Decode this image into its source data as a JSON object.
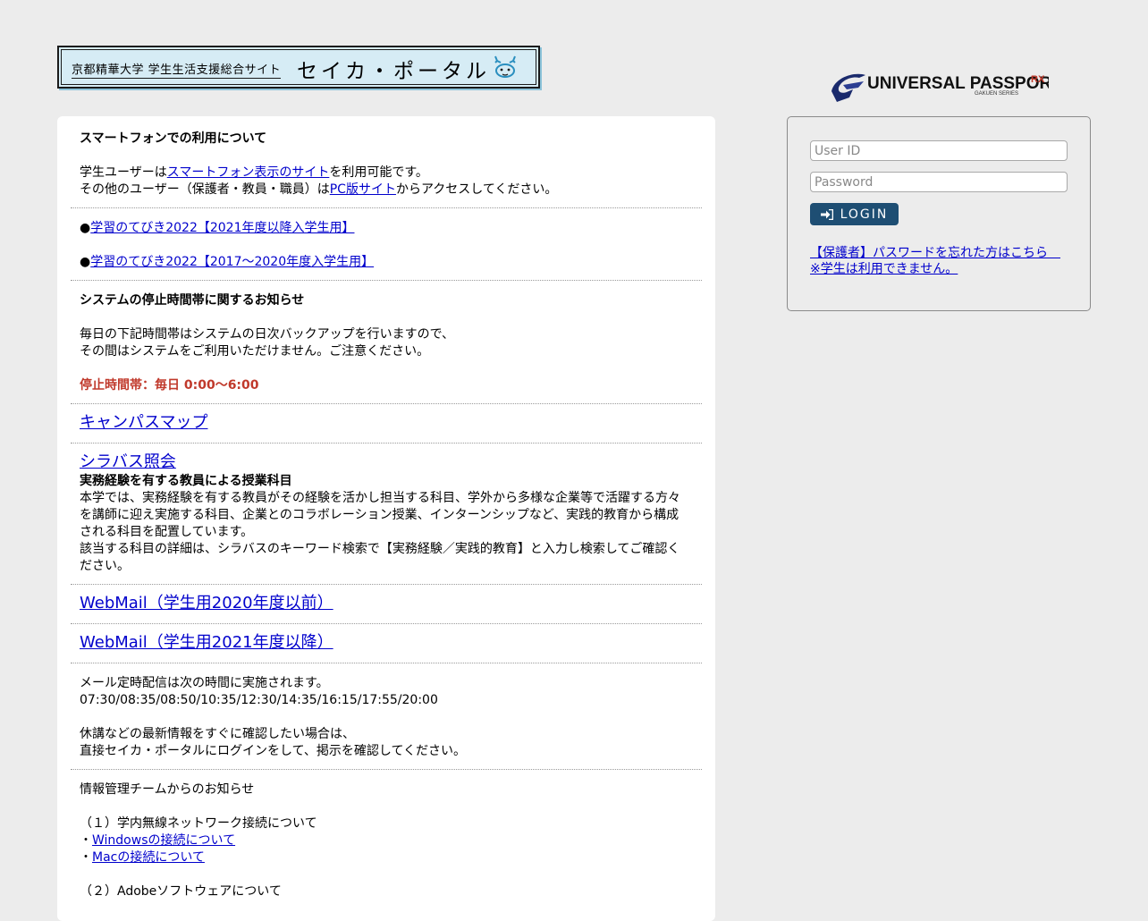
{
  "banner": {
    "subtitle": "京都精華大学 学生生活支援総合サイト",
    "title": "セイカ・ポータル"
  },
  "notice_smartphone": {
    "heading": "スマートフォンでの利用について",
    "line1_before": "学生ユーザーは",
    "line1_link": "スマートフォン表示のサイト",
    "line1_after": "を利用可能です。",
    "line2_before": "その他のユーザー（保護者・教員・職員）は",
    "line2_link": "PC版サイト",
    "line2_after": "からアクセスしてください。"
  },
  "guides": {
    "bullet": "●",
    "link1": "学習のてびき2022【2021年度以降入学生用】",
    "link2": "学習のてびき2022【2017～2020年度入学生用】"
  },
  "maintenance": {
    "heading": "システムの停止時間帯に関するお知らせ",
    "line1": "毎日の下記時間帯はシステムの日次バックアップを行いますので、",
    "line2": "その間はシステムをご利用いただけません。ご注意ください。",
    "stop_time": "停止時間帯：毎日 0:00～6:00"
  },
  "campus_map": {
    "link": "キャンパスマップ"
  },
  "syllabus": {
    "link": "シラバス照会",
    "heading": "実務経験を有する教員による授業科目",
    "line1": "本学では、実務経験を有する教員がその経験を活かし担当する科目、学外から多様な企業等で活躍する方々",
    "line2": "を講師に迎え実施する科目、企業とのコラボレーション授業、インターンシップなど、実践的教育から構成",
    "line3": "される科目を配置しています。",
    "line4": "該当する科目の詳細は、シラバスのキーワード検索で【実務経験／実践的教育】と入力し検索してご確認く",
    "line5": "ださい。"
  },
  "webmail": {
    "link_old": "WebMail（学生用2020年度以前）",
    "link_new": "WebMail（学生用2021年度以降）"
  },
  "mail_schedule": {
    "line1": "メール定時配信は次の時間に実施されます。",
    "times": "07:30/08:35/08:50/10:35/12:30/14:35/16:15/17:55/20:00",
    "line3": "休講などの最新情報をすぐに確認したい場合は、",
    "line4": "直接セイカ・ポータルにログインをして、掲示を確認してください。"
  },
  "it_notice": {
    "heading": "情報管理チームからのお知らせ",
    "item1": "（１）学内無線ネットワーク接続について",
    "bullet": "・",
    "win_link": "Windowsの接続について",
    "mac_link": "Macの接続について",
    "item2": "（２）Adobeソフトウェアについて"
  },
  "logo": {
    "text": "UNIVERSAL PASSPORT",
    "suffix": "RX",
    "sub": "GAKUEN SERIES"
  },
  "login": {
    "userid_placeholder": "User ID",
    "password_placeholder": "Password",
    "button": "LOGIN",
    "forgot_line1": "【保護者】パスワードを忘れた方はこちら　",
    "forgot_line2": "※学生は利用できません。"
  },
  "colors": {
    "login_button": "#1e4e73",
    "link": "#0000cc",
    "alert": "#c0392b"
  }
}
